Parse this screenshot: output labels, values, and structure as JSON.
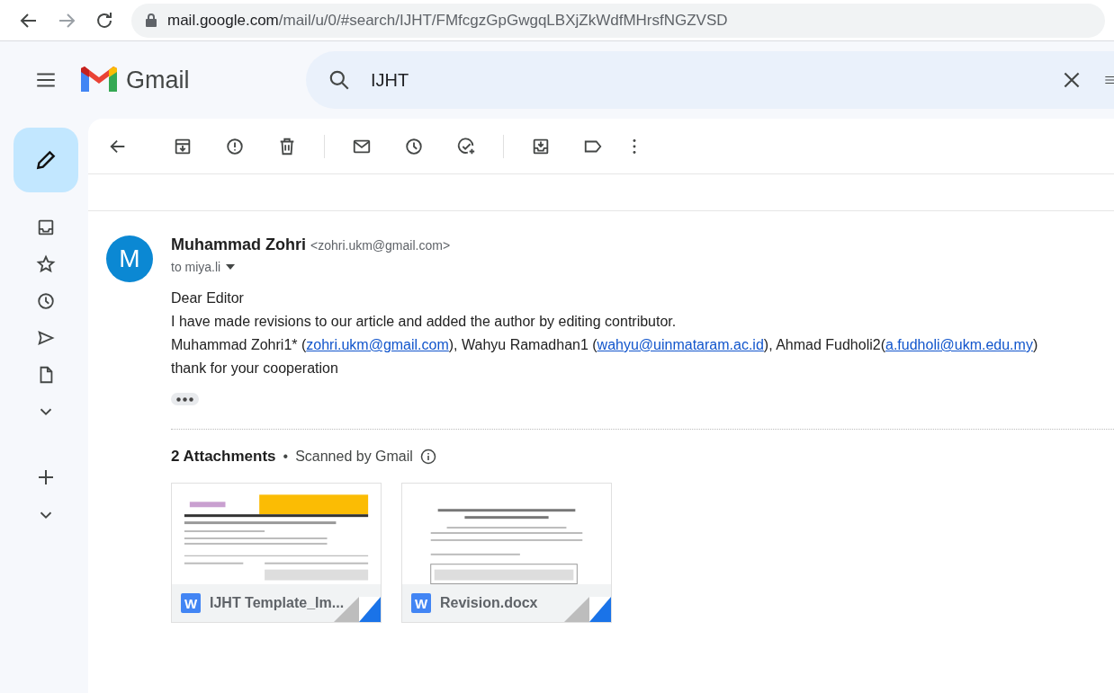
{
  "browser": {
    "url_host": "mail.google.com",
    "url_path": "/mail/u/0/#search/IJHT/FMfcgzGpGwgqLBXjZkWdfMHrsfNGZVSD"
  },
  "header": {
    "app_name": "Gmail",
    "search_value": "IJHT"
  },
  "message": {
    "avatar_letter": "M",
    "sender_name": "Muhammad Zohri",
    "sender_email": "<zohri.ukm@gmail.com>",
    "recipient": "to miya.li",
    "body": [
      {
        "parts": [
          {
            "text": "Dear Editor"
          }
        ]
      },
      {
        "parts": [
          {
            "text": "I have made revisions to our article and added the author by editing contributor."
          }
        ]
      },
      {
        "parts": [
          {
            "text": "Muhammad Zohri1* ("
          },
          {
            "link": "zohri.ukm@gmail.com"
          },
          {
            "text": "), Wahyu Ramadhan1 ("
          },
          {
            "link": "wahyu@uinmataram.ac.id"
          },
          {
            "text": "), Ahmad Fudholi2("
          },
          {
            "link": "a.fudholi@ukm.edu.my"
          },
          {
            "text": ")"
          }
        ]
      },
      {
        "parts": [
          {
            "text": "thank for your cooperation"
          }
        ]
      }
    ],
    "attachments_title": "2 Attachments",
    "separator": "•",
    "scanned_note": "Scanned by Gmail",
    "attachments": [
      {
        "icon_letter": "W",
        "name": "IJHT Template_Im...",
        "kind": "banner"
      },
      {
        "icon_letter": "W",
        "name": "Revision.docx",
        "kind": "table"
      }
    ]
  }
}
